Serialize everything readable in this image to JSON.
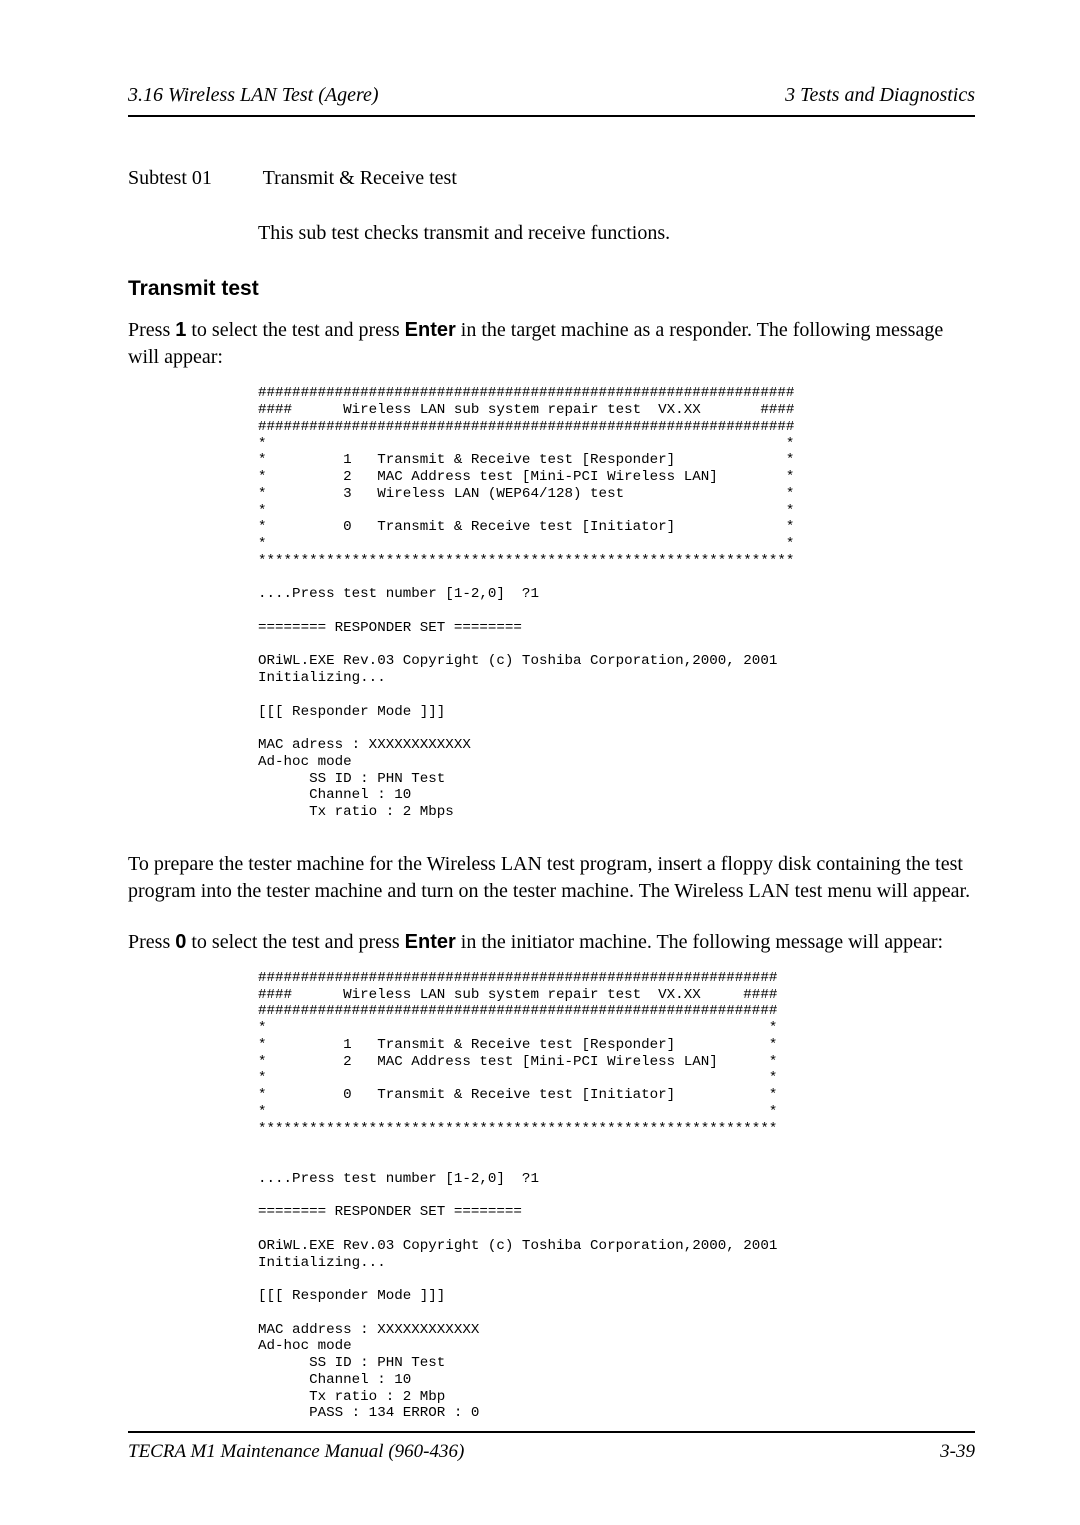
{
  "header": {
    "left": "3.16  Wireless LAN Test  (Agere)",
    "right": "3   Tests and Diagnostics"
  },
  "subtest": {
    "label": "Subtest 01",
    "title": "Transmit & Receive test",
    "desc": "This sub test checks transmit and receive functions."
  },
  "transmit": {
    "heading": "Transmit test",
    "para_pre": "Press ",
    "para_key1": "1",
    "para_mid": " to select the test and press ",
    "para_key2": "Enter",
    "para_post": " in the target machine as a responder. The following message will appear:"
  },
  "code1": "###############################################################\n####      Wireless LAN sub system repair test  VX.XX       ####\n###############################################################\n*                                                             *\n*         1   Transmit & Receive test [Responder]             *\n*         2   MAC Address test [Mini-PCI Wireless LAN]        *\n*         3   Wireless LAN (WEP64/128) test                   *\n*                                                             *\n*         0   Transmit & Receive test [Initiator]             *\n*                                                             *\n***************************************************************\n\n....Press test number [1-2,0]  ?1\n\n======== RESPONDER SET ========\n\nORiWL.EXE Rev.03 Copyright (c) Toshiba Corporation,2000, 2001\nInitializing...\n\n[[[ Responder Mode ]]]\n\nMAC adress : XXXXXXXXXXXX\nAd-hoc mode\n      SS ID : PHN Test\n      Channel : 10\n      Tx ratio : 2 Mbps",
  "mid": {
    "para1": "To prepare the tester machine for the Wireless LAN test program, insert a floppy disk containing the test program into the tester machine and turn on the tester machine. The Wireless LAN test menu will appear.",
    "para2_pre": "Press ",
    "para2_key1": "0",
    "para2_mid": " to select the test and press ",
    "para2_key2": "Enter",
    "para2_post": " in the initiator machine. The following message will appear:"
  },
  "code2": "#############################################################\n####      Wireless LAN sub system repair test  VX.XX     ####\n#############################################################\n*                                                           *\n*         1   Transmit & Receive test [Responder]           *\n*         2   MAC Address test [Mini-PCI Wireless LAN]      *\n*                                                           *\n*         0   Transmit & Receive test [Initiator]           *\n*                                                           *\n*************************************************************\n\n\n....Press test number [1-2,0]  ?1\n\n======== RESPONDER SET ========\n\nORiWL.EXE Rev.03 Copyright (c) Toshiba Corporation,2000, 2001\nInitializing...\n\n[[[ Responder Mode ]]]\n\nMAC address : XXXXXXXXXXXX\nAd-hoc mode\n      SS ID : PHN Test\n      Channel : 10\n      Tx ratio : 2 Mbp\n      PASS : 134 ERROR : 0",
  "footer": {
    "left": "TECRA M1 Maintenance Manual (960-436)",
    "right": "3-39"
  }
}
